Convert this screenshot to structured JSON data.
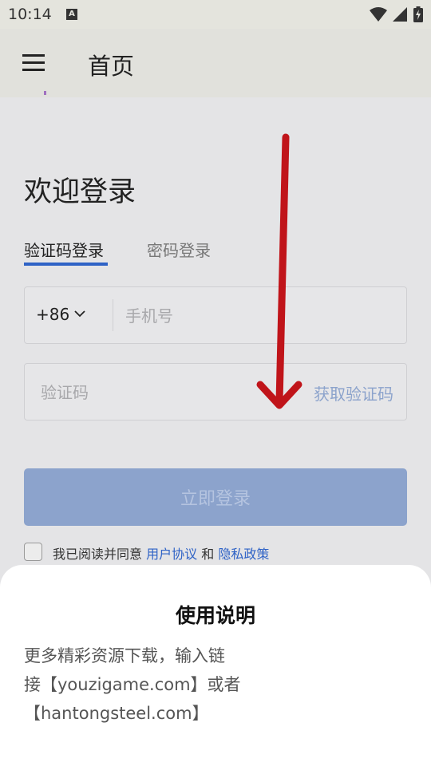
{
  "status_bar": {
    "time": "10:14",
    "notification_letter": "A"
  },
  "app_bar": {
    "title": "首页"
  },
  "login": {
    "heading": "欢迎登录",
    "tabs": [
      {
        "label": "验证码登录",
        "active": true
      },
      {
        "label": "密码登录",
        "active": false
      }
    ],
    "country_code": "+86",
    "phone_placeholder": "手机号",
    "code_placeholder": "验证码",
    "get_code_label": "获取验证码",
    "submit_label": "立即登录",
    "agreement": {
      "prefix": "我已阅读并同意",
      "user_agreement": "用户协议",
      "conjunction": "和",
      "privacy_policy": "隐私政策"
    }
  },
  "sheet": {
    "title": "使用说明",
    "line1": "更多精彩资源下载，输入链",
    "line2": "接【youzigame.com】或者",
    "line3": "【hantongsteel.com】"
  },
  "colors": {
    "accent": "#2e62c6",
    "button_disabled": "#8ca3cc",
    "arrow": "#c0141a"
  }
}
